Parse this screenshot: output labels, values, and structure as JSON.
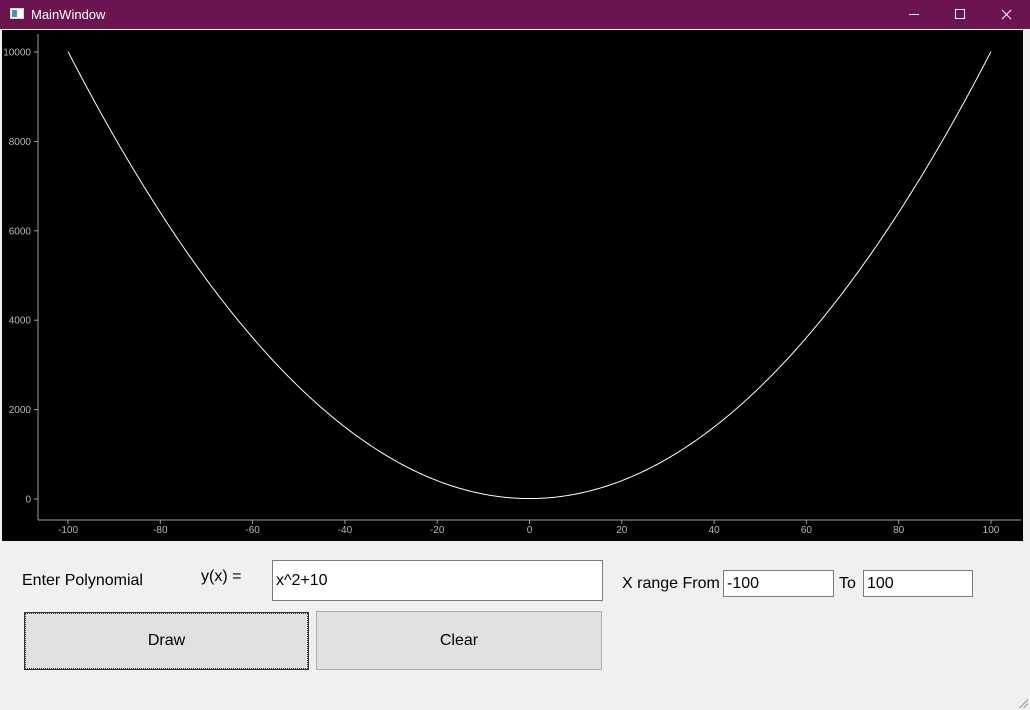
{
  "window": {
    "title": "MainWindow"
  },
  "chart_data": {
    "type": "line",
    "function": "x^2+10",
    "x_range": [
      -100,
      100
    ],
    "ylim": [
      0,
      10000
    ],
    "x_ticks": [
      -100,
      -80,
      -60,
      -40,
      -20,
      0,
      20,
      40,
      60,
      80,
      100
    ],
    "y_ticks": [
      0,
      2000,
      4000,
      6000,
      8000,
      10000
    ],
    "series": [
      {
        "x": [
          -100,
          -80,
          -60,
          -40,
          -20,
          0,
          20,
          40,
          60,
          80,
          100
        ],
        "y": [
          10010,
          6410,
          3610,
          1610,
          410,
          10,
          410,
          1610,
          3610,
          6410,
          10010
        ]
      }
    ],
    "line_color": "#ffffff",
    "background": "#000000",
    "grid": false
  },
  "form": {
    "enter_polynomial_label": "Enter Polynomial",
    "yx_label": "y(x) =",
    "polynomial_value": "x^2+10",
    "x_range_from_label": "X range From",
    "x_from_value": "-100",
    "to_label": "To",
    "x_to_value": "100",
    "draw_label": "Draw",
    "clear_label": "Clear"
  }
}
